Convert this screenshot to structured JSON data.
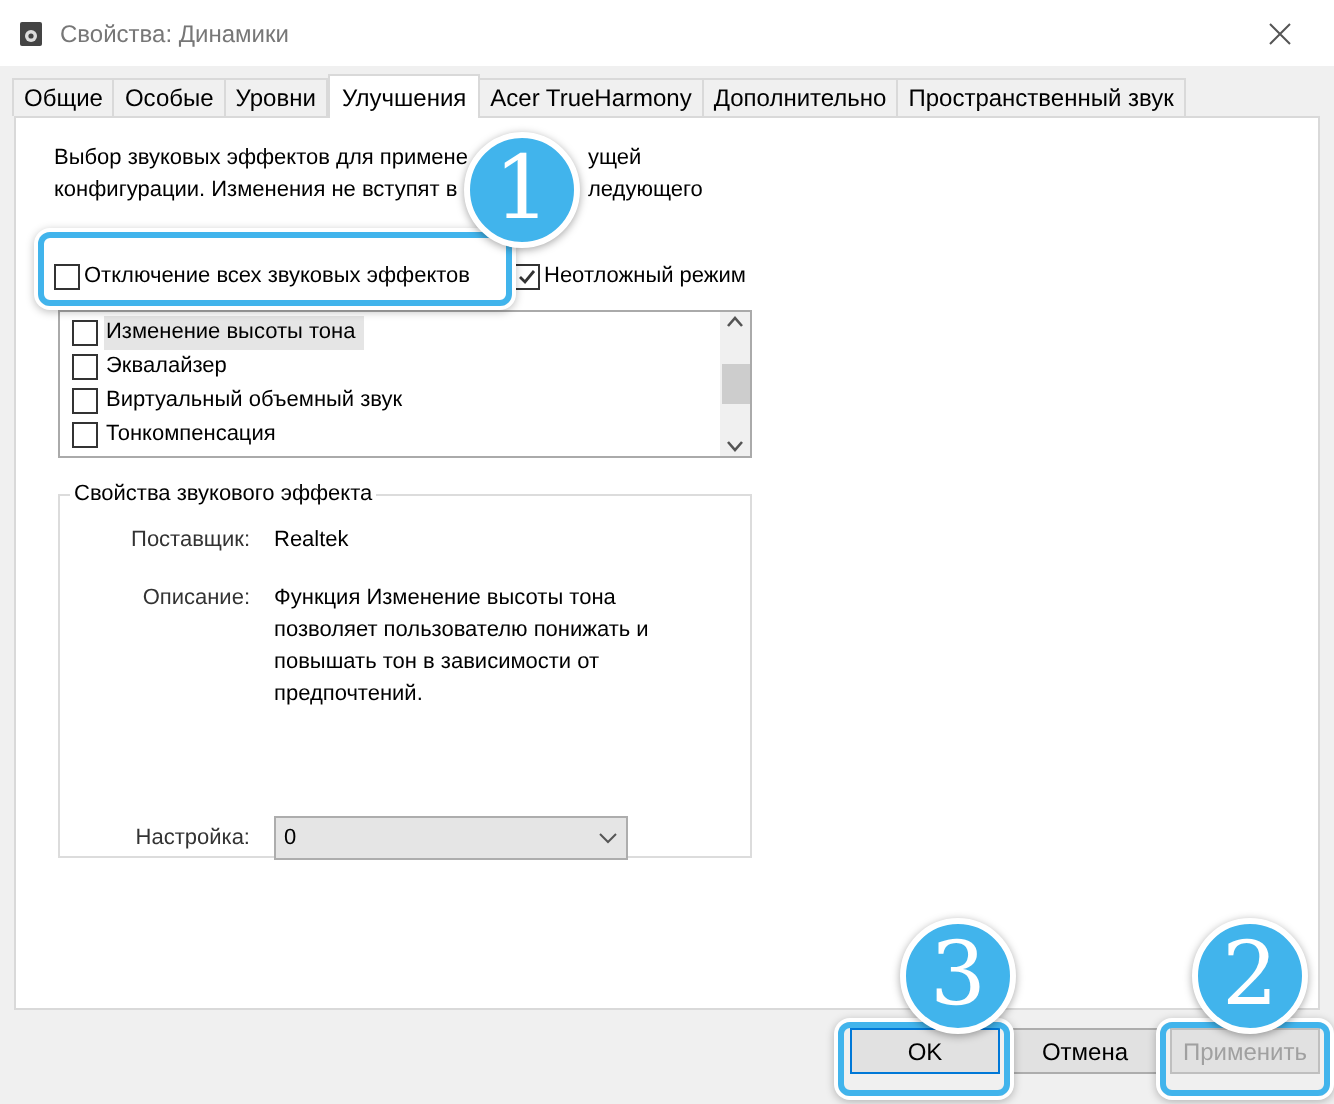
{
  "window": {
    "title": "Свойства: Динамики"
  },
  "tabs": [
    {
      "label": "Общие",
      "selected": false
    },
    {
      "label": "Особые",
      "selected": false
    },
    {
      "label": "Уровни",
      "selected": false
    },
    {
      "label": "Улучшения",
      "selected": true
    },
    {
      "label": "Acer TrueHarmony",
      "selected": false
    },
    {
      "label": "Дополнительно",
      "selected": false
    },
    {
      "label": "Пространственный звук",
      "selected": false
    }
  ],
  "intro": [
    {
      "left": "Выбор звуковых эффектов для примене",
      "right": "ущей"
    },
    {
      "left": "конфигурации. Изменения не вступят в",
      "right": "ледующего"
    }
  ],
  "options": [
    {
      "label": "Отключение всех звуковых эффектов",
      "checked": false
    },
    {
      "label": "Неотложный режим",
      "checked": true
    }
  ],
  "effects": [
    {
      "label": "Изменение высоты тона",
      "checked": false,
      "selected": true
    },
    {
      "label": "Эквалайзер",
      "checked": false,
      "selected": false
    },
    {
      "label": "Виртуальный объемный звук",
      "checked": false,
      "selected": false
    },
    {
      "label": "Тонкомпенсация",
      "checked": false,
      "selected": false
    }
  ],
  "properties": {
    "legend": "Свойства звукового эффекта",
    "rows": [
      {
        "label": "Поставщик:",
        "value": "Realtek"
      },
      {
        "label": "Описание:",
        "value": "Функция Изменение высоты тона позволяет пользователю понижать и повышать тон в зависимости от предпочтений."
      }
    ],
    "setting": {
      "label": "Настройка:",
      "value": "0"
    }
  },
  "buttons": [
    {
      "label": "OK",
      "default": true,
      "disabled": false
    },
    {
      "label": "Отмена",
      "default": false,
      "disabled": false
    },
    {
      "label": "Применить",
      "default": false,
      "disabled": true
    }
  ],
  "callouts": [
    {
      "number": "1"
    },
    {
      "number": "3"
    },
    {
      "number": "2"
    }
  ]
}
